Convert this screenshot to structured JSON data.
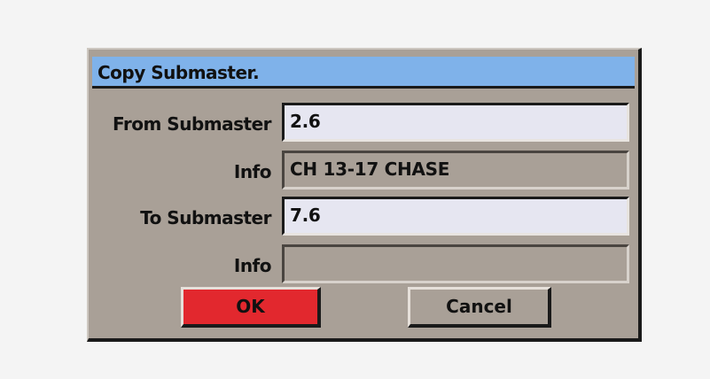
{
  "dialog": {
    "title": "Copy Submaster.",
    "from_label": "From Submaster",
    "from_value": "2.6",
    "from_info_label": "Info",
    "from_info_value": "CH 13-17 CHASE",
    "to_label": "To Submaster",
    "to_value": "7.6",
    "to_info_label": "Info",
    "to_info_value": "",
    "ok_label": "OK",
    "cancel_label": "Cancel"
  },
  "colors": {
    "title_bar": "#7fb2ea",
    "dialog_bg": "#a9a097",
    "input_bg": "#e6e6f1",
    "ok_button": "#e2282e"
  }
}
